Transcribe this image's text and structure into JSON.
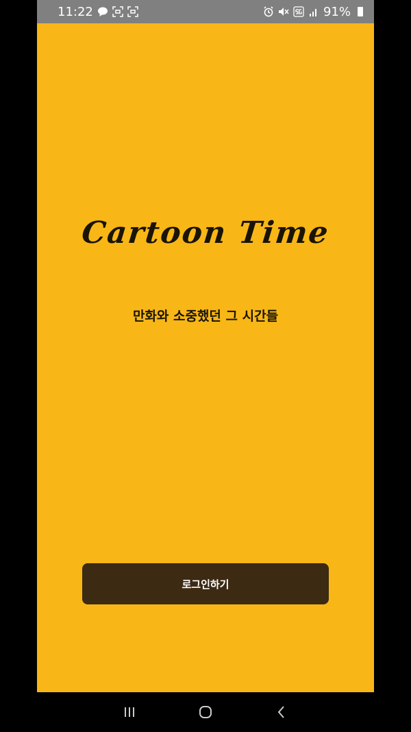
{
  "status_bar": {
    "time": "11:22",
    "battery": "91%",
    "icons_left": [
      "talk-icon",
      "screenshot-icon",
      "scan-icon"
    ],
    "icons_right": [
      "alarm-icon",
      "mute-icon",
      "5g-icon",
      "signal-icon",
      "battery-icon"
    ]
  },
  "app": {
    "logo_text": "Cartoon Time",
    "tagline": "만화와 소중했던 그 시간들",
    "login_label": "로그인하기"
  },
  "colors": {
    "background": "#F8B716",
    "button": "#3C2A13",
    "status_bar": "#808080"
  },
  "nav_bar": {
    "buttons": [
      "recent-apps-icon",
      "home-icon",
      "back-icon"
    ]
  }
}
